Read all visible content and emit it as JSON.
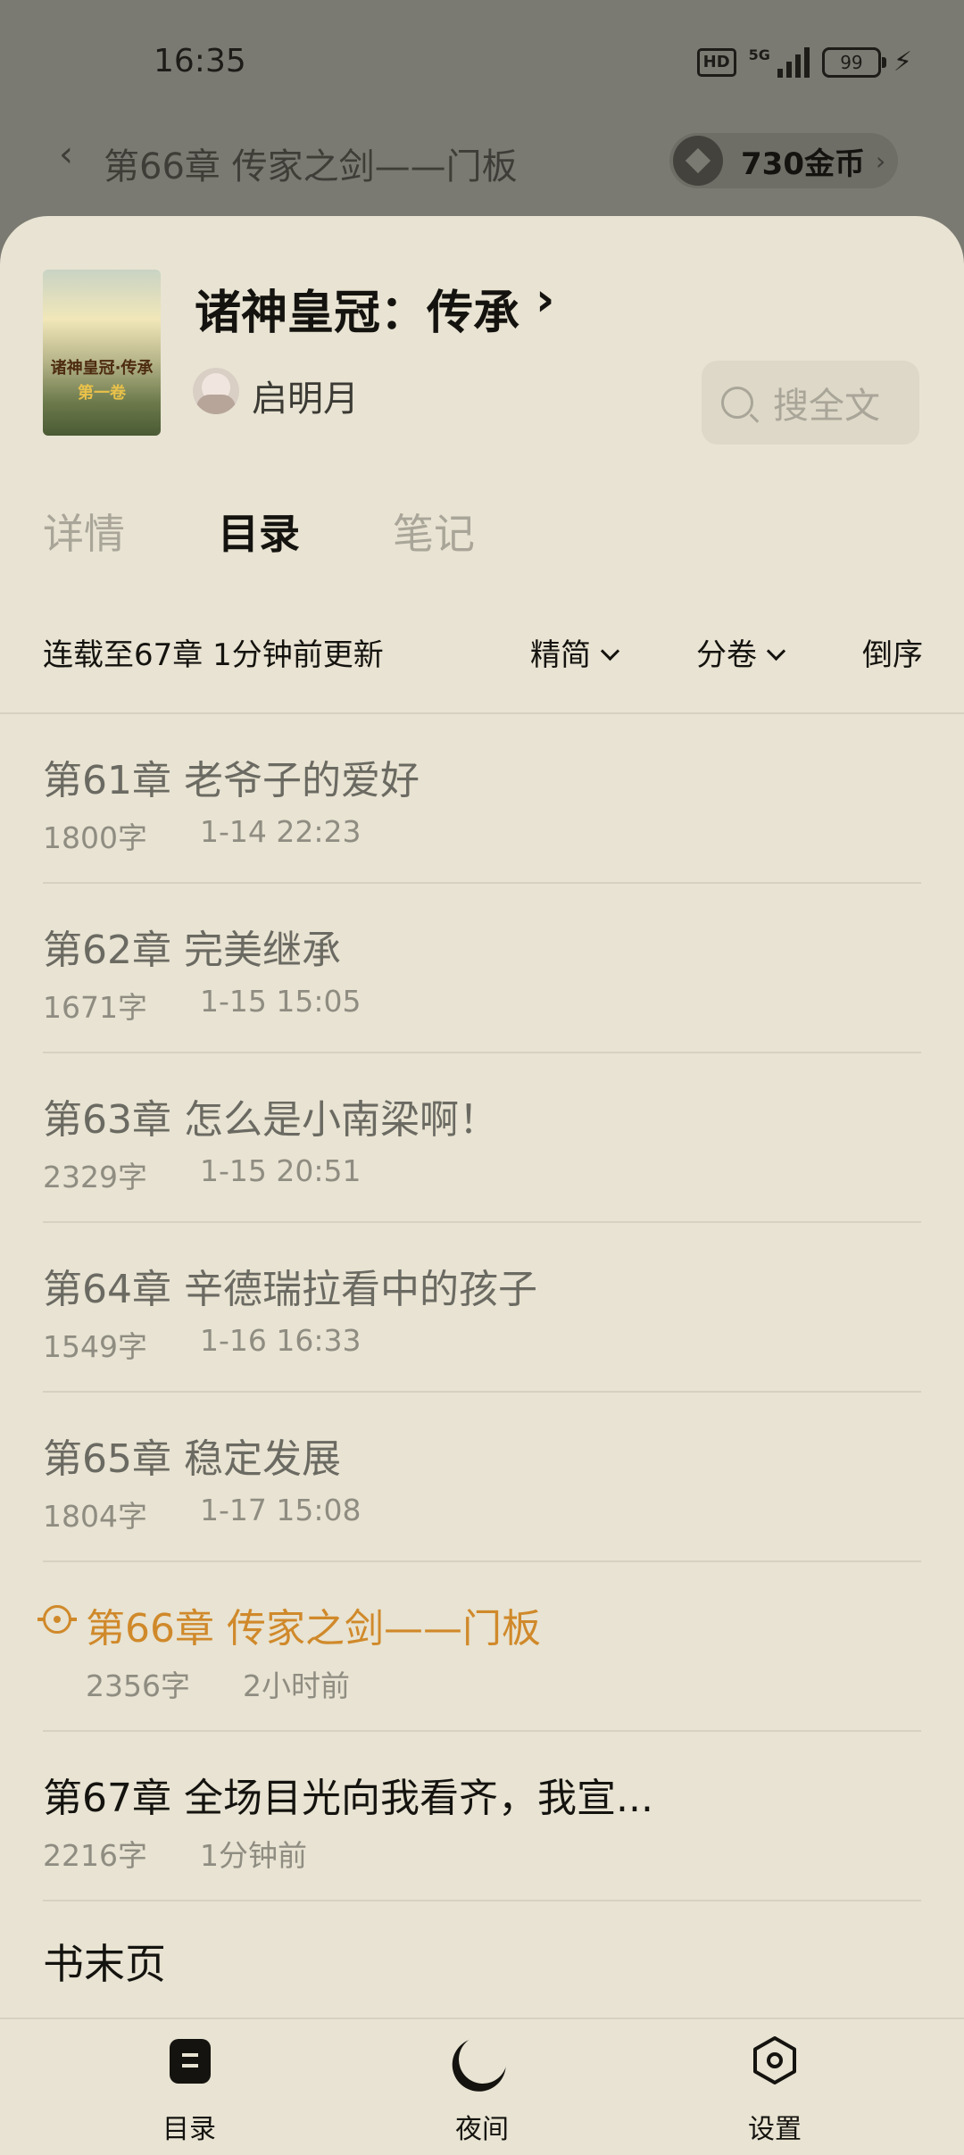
{
  "status_bar": {
    "time": "16:35",
    "hd": "HD",
    "network": "5G",
    "battery": "99",
    "charging": "⚡"
  },
  "reader": {
    "back_icon": "‹",
    "chapter_title": "第66章 传家之剑——门板",
    "coins": "730金币",
    "coins_arrow": "›"
  },
  "book": {
    "cover_title": "诸神皇冠·传承",
    "cover_subtitle": "第一卷",
    "title": "诸神皇冠：传承",
    "title_arrow": "›",
    "author": "启明月",
    "search_placeholder": "搜全文"
  },
  "tabs": [
    {
      "label": "详情",
      "active": false
    },
    {
      "label": "目录",
      "active": true
    },
    {
      "label": "笔记",
      "active": false
    }
  ],
  "toc_meta": {
    "update_text": "连载至67章 1分钟前更新",
    "filter_simplified": "精简",
    "filter_volume": "分卷",
    "sort": "倒序"
  },
  "chapters": [
    {
      "title": "第61章 老爷子的爱好",
      "words": "1800字",
      "date": "1-14 22:23",
      "state": "read"
    },
    {
      "title": "第62章 完美继承",
      "words": "1671字",
      "date": "1-15 15:05",
      "state": "read"
    },
    {
      "title": "第63章 怎么是小南梁啊！",
      "words": "2329字",
      "date": "1-15 20:51",
      "state": "read"
    },
    {
      "title": "第64章 辛德瑞拉看中的孩子",
      "words": "1549字",
      "date": "1-16 16:33",
      "state": "read"
    },
    {
      "title": "第65章 稳定发展",
      "words": "1804字",
      "date": "1-17 15:08",
      "state": "read"
    },
    {
      "title": "第66章 传家之剑——门板",
      "words": "2356字",
      "date": "2小时前",
      "state": "current"
    },
    {
      "title": "第67章 全场目光向我看齐，我宣...",
      "words": "2216字",
      "date": "1分钟前",
      "state": "unread"
    }
  ],
  "book_end": "书末页",
  "bottom_nav": {
    "toc": "目录",
    "night": "夜间",
    "settings": "设置"
  },
  "colors": {
    "sheet_bg": "#e8e3d2",
    "accent": "#d0892a",
    "text": "#14130f",
    "muted": "#8f8c81"
  }
}
